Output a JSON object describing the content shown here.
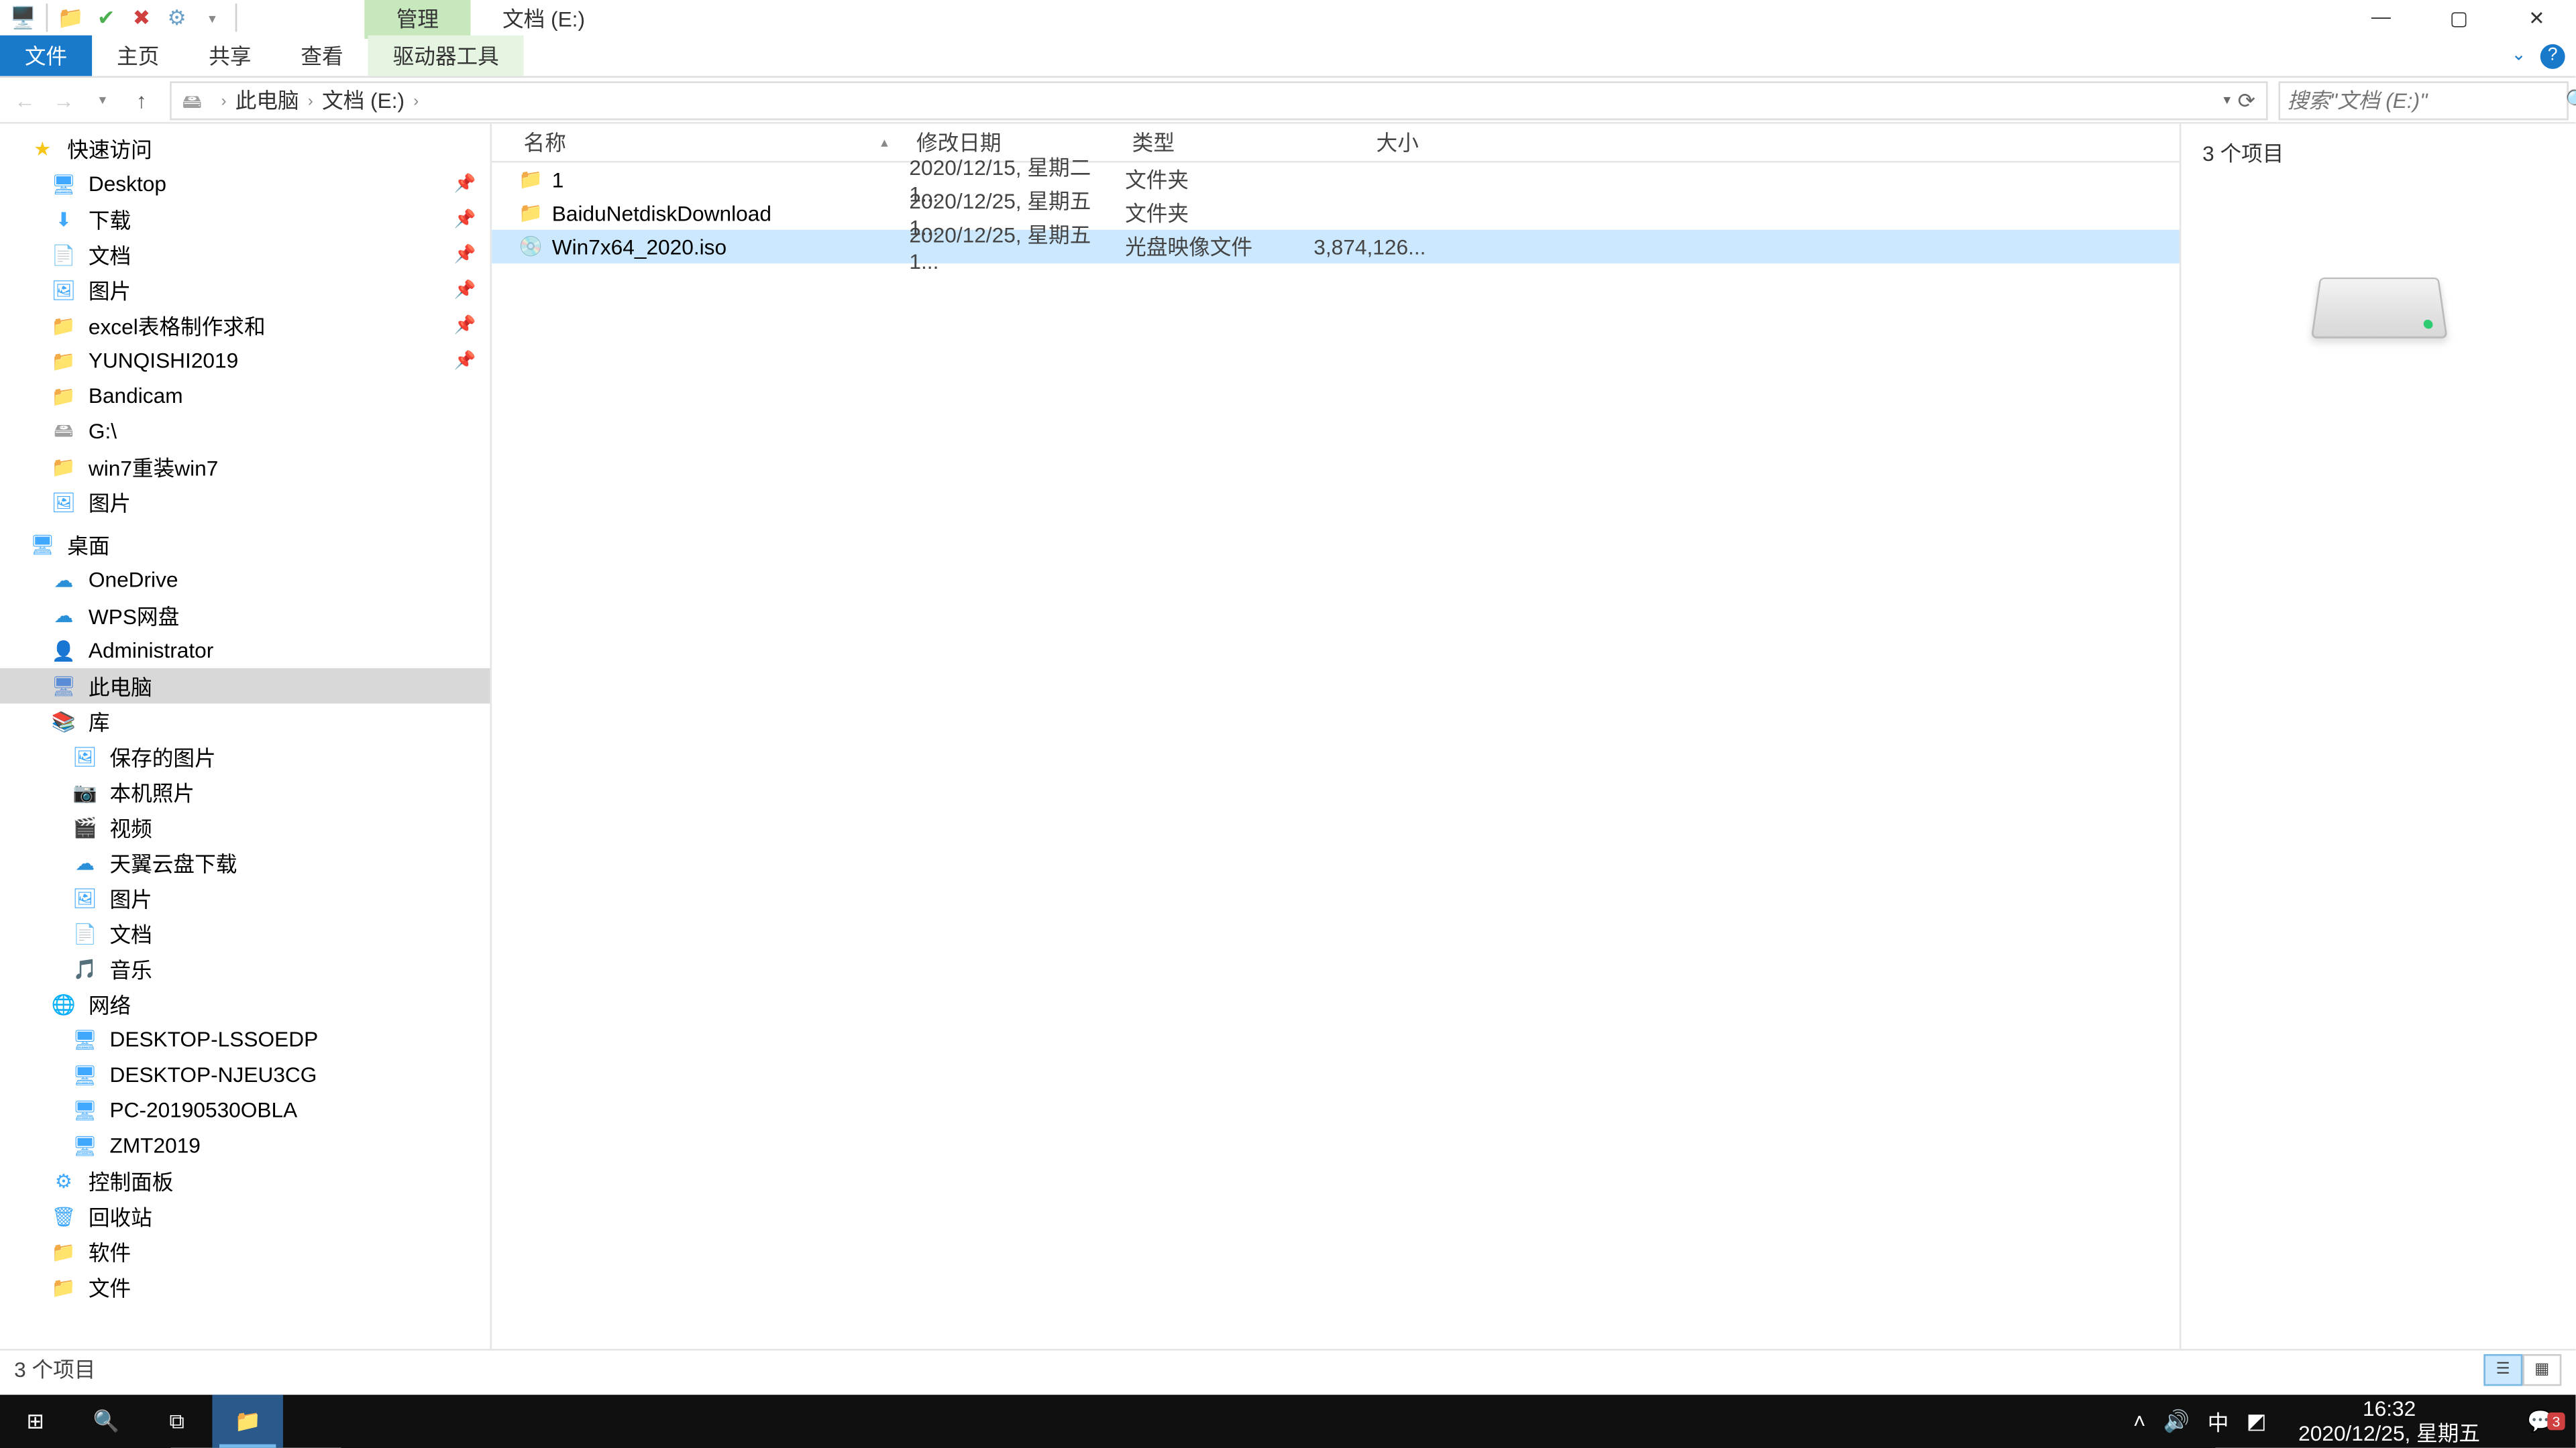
{
  "titlebar": {
    "contextual_tab": "管理",
    "title": "文档 (E:)"
  },
  "ribbon": {
    "file": "文件",
    "tabs": [
      "主页",
      "共享",
      "查看"
    ],
    "contextual": "驱动器工具"
  },
  "nav": {
    "breadcrumb": [
      "此电脑",
      "文档 (E:)"
    ],
    "search_placeholder": "搜索\"文档 (E:)\""
  },
  "columns": {
    "name": "名称",
    "date": "修改日期",
    "type": "类型",
    "size": "大小"
  },
  "files": [
    {
      "icon": "folder",
      "name": "1",
      "date": "2020/12/15, 星期二 1...",
      "type": "文件夹",
      "size": ""
    },
    {
      "icon": "folder",
      "name": "BaiduNetdiskDownload",
      "date": "2020/12/25, 星期五 1...",
      "type": "文件夹",
      "size": ""
    },
    {
      "icon": "disc",
      "name": "Win7x64_2020.iso",
      "date": "2020/12/25, 星期五 1...",
      "type": "光盘映像文件",
      "size": "3,874,126...",
      "selected": true
    }
  ],
  "preview": {
    "count_text": "3 个项目"
  },
  "statusbar": {
    "text": "3 个项目"
  },
  "navpane": {
    "quick_access": {
      "label": "快速访问",
      "items": [
        {
          "icon": "desktop",
          "label": "Desktop",
          "pinned": true
        },
        {
          "icon": "download",
          "label": "下载",
          "pinned": true
        },
        {
          "icon": "doc",
          "label": "文档",
          "pinned": true
        },
        {
          "icon": "pic",
          "label": "图片",
          "pinned": true
        },
        {
          "icon": "folder",
          "label": "excel表格制作求和",
          "pinned": true
        },
        {
          "icon": "folder",
          "label": "YUNQISHI2019",
          "pinned": true
        },
        {
          "icon": "folder",
          "label": "Bandicam"
        },
        {
          "icon": "drive",
          "label": "G:\\"
        },
        {
          "icon": "folder",
          "label": "win7重装win7"
        },
        {
          "icon": "pic",
          "label": "图片"
        }
      ]
    },
    "desktop_root": {
      "label": "桌面",
      "items": [
        {
          "icon": "onedrive",
          "label": "OneDrive"
        },
        {
          "icon": "wps",
          "label": "WPS网盘"
        },
        {
          "icon": "user",
          "label": "Administrator"
        },
        {
          "icon": "pc",
          "label": "此电脑",
          "selected": true
        },
        {
          "icon": "lib",
          "label": "库",
          "children": [
            {
              "icon": "savedpic",
              "label": "保存的图片"
            },
            {
              "icon": "camera",
              "label": "本机照片"
            },
            {
              "icon": "video",
              "label": "视频"
            },
            {
              "icon": "cloud",
              "label": "天翼云盘下载"
            },
            {
              "icon": "pic",
              "label": "图片"
            },
            {
              "icon": "doc",
              "label": "文档"
            },
            {
              "icon": "music",
              "label": "音乐"
            }
          ]
        },
        {
          "icon": "network",
          "label": "网络",
          "children": [
            {
              "icon": "netpc",
              "label": "DESKTOP-LSSOEDP"
            },
            {
              "icon": "netpc",
              "label": "DESKTOP-NJEU3CG"
            },
            {
              "icon": "netpc",
              "label": "PC-20190530OBLA"
            },
            {
              "icon": "netpc",
              "label": "ZMT2019"
            }
          ]
        },
        {
          "icon": "control",
          "label": "控制面板"
        },
        {
          "icon": "recycle",
          "label": "回收站"
        },
        {
          "icon": "folder",
          "label": "软件"
        },
        {
          "icon": "folder",
          "label": "文件"
        }
      ]
    }
  },
  "taskbar": {
    "time": "16:32",
    "date": "2020/12/25, 星期五",
    "ime": "中",
    "notif_count": "3"
  }
}
